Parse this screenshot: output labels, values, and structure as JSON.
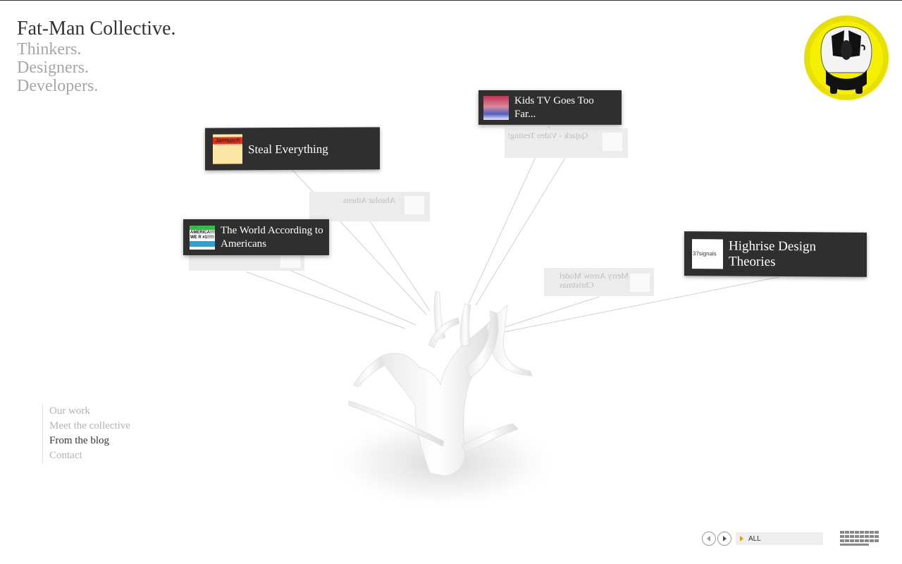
{
  "brand": {
    "title": "Fat-Man Collective.",
    "tagline": [
      "Thinkers.",
      "Designers.",
      "Developers."
    ]
  },
  "nav": {
    "items": [
      {
        "label": "Our work",
        "active": false
      },
      {
        "label": "Meet the collective",
        "active": false
      },
      {
        "label": "From the blog",
        "active": true
      },
      {
        "label": "Contact",
        "active": false
      }
    ]
  },
  "cards": [
    {
      "title": "Steal Everything",
      "thumb_label": "Jarmusch"
    },
    {
      "title": "Kids TV Goes Too Far..."
    },
    {
      "title": "The World According to Americans",
      "thumb_label": "AMERICA!!!!! WE R #1!!!!!"
    },
    {
      "title": "Highrise Design Theories",
      "thumb_label": "37signals"
    }
  ],
  "ghost_cards": [
    {
      "title": "Qajack - Video Testing!"
    },
    {
      "title": "Absolut Athens"
    },
    {
      "title": "Merry Arrow Model Christmas"
    },
    {
      "title": ""
    }
  ],
  "controls": {
    "filter_label": "ALL",
    "prev_icon": "chevron-left-icon",
    "next_icon": "chevron-right-icon",
    "grid_icon": "grid-view-icon"
  },
  "colors": {
    "card_bg": "#2f2f2f",
    "nav_active": "#333333",
    "nav_inactive": "#b3b3b3",
    "mascot_yellow": "#e8e000",
    "filter_arrow": "#e0a000"
  }
}
